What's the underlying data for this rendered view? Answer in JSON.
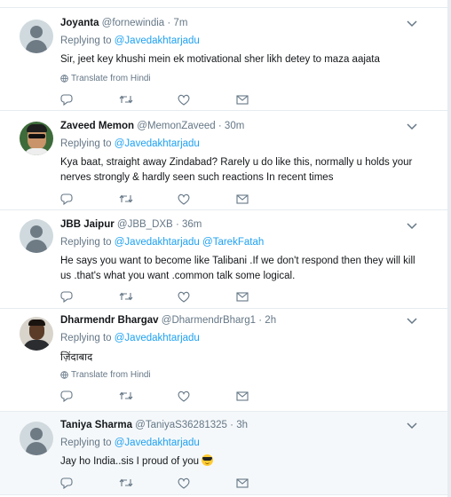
{
  "tweets": [
    {
      "name": "Joyanta",
      "handle": "@fornewindia",
      "separator": "·",
      "time": "7m",
      "replying_prefix": "Replying to",
      "mentions": [
        "@Javedakhtarjadu"
      ],
      "text": "Sir,  jeet key khushi mein ek motivational sher likh detey to maza aajata",
      "translate": "Translate from Hindi",
      "avatar": "default-avatar"
    },
    {
      "name": "Zaveed Memon",
      "handle": "@MemonZaveed",
      "separator": "·",
      "time": "30m",
      "replying_prefix": "Replying to",
      "mentions": [
        "@Javedakhtarjadu"
      ],
      "text": "Kya baat, straight away Zindabad? Rarely u do like this, normally u holds your nerves strongly & hardly seen such reactions In recent times",
      "avatar": "photo-sunglasses"
    },
    {
      "name": "JBB Jaipur",
      "handle": "@JBB_DXB",
      "separator": "·",
      "time": "36m",
      "replying_prefix": "Replying to",
      "mentions": [
        "@Javedakhtarjadu",
        "@TarekFatah"
      ],
      "text": "He says you want to become like Talibani .If we don't respond then they will kill us .that's what you want .common talk some logical.",
      "avatar": "default-avatar"
    },
    {
      "name": "Dharmendr Bhargav",
      "handle": "@DharmendrBharg1",
      "separator": "·",
      "time": "2h",
      "replying_prefix": "Replying to",
      "mentions": [
        "@Javedakhtarjadu"
      ],
      "text": "ज़िंदाबाद",
      "translate": "Translate from Hindi",
      "avatar": "photo-man"
    },
    {
      "name": "Taniya Sharma",
      "handle": "@TaniyaS36281325",
      "separator": "·",
      "time": "3h",
      "replying_prefix": "Replying to",
      "mentions": [
        "@Javedakhtarjadu"
      ],
      "text": "Jay ho India..sis I proud of you",
      "emoji": "smiling-face-with-sunglasses",
      "avatar": "default-avatar"
    }
  ],
  "icons": {
    "reply": "reply-icon",
    "retweet": "retweet-icon",
    "like": "heart-icon",
    "dm": "envelope-icon",
    "menu": "chevron-down-icon",
    "globe": "globe-icon"
  },
  "colors": {
    "link": "#1da1f2",
    "meta": "#657786",
    "text": "#14171a",
    "divider": "#e6ecf0",
    "highlight_bg": "#f5f8fa"
  }
}
